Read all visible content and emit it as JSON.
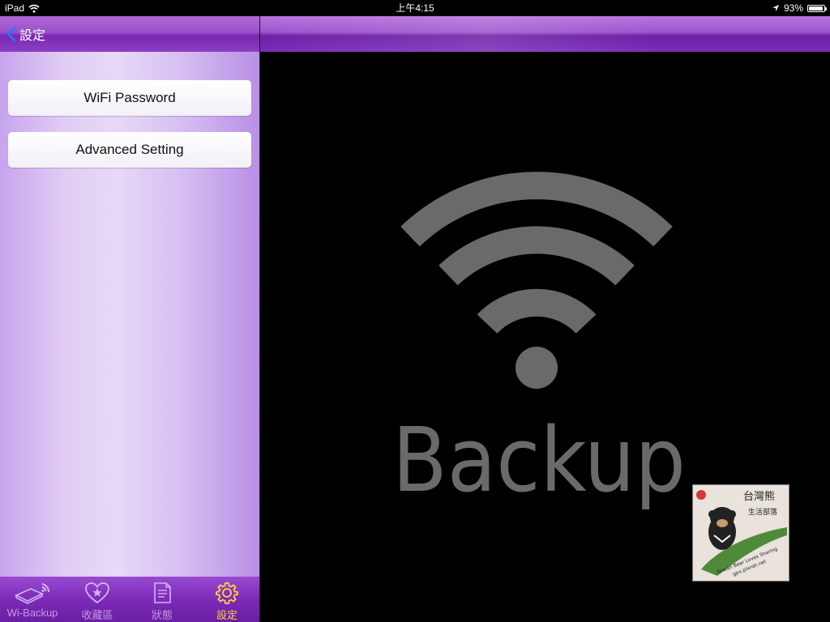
{
  "status_bar": {
    "device": "iPad",
    "time": "上午4:15",
    "battery": "93%",
    "battery_level": 0.93
  },
  "nav": {
    "back_label": "設定"
  },
  "menu": {
    "wifi_password": "WiFi Password",
    "advanced_setting": "Advanced Setting"
  },
  "logo": {
    "text": "Backup"
  },
  "tabs": [
    {
      "label": "Wi-Backup",
      "icon": "wifi-drive-icon",
      "active": false
    },
    {
      "label": "收藏區",
      "icon": "heart-star-icon",
      "active": false
    },
    {
      "label": "狀態",
      "icon": "document-icon",
      "active": false
    },
    {
      "label": "設定",
      "icon": "gear-icon",
      "active": true
    }
  ],
  "colors": {
    "accent_purple": "#7c2bb8",
    "active_tab": "#ffd23c",
    "back_chevron": "#1e7cff",
    "logo_gray": "#6a6a6a"
  },
  "watermark": {
    "title": "台灣熊",
    "subtitle": "生活部落",
    "caption": "Taiwan Bear Loves Sharing",
    "url": "gpx.pixnet.net"
  }
}
